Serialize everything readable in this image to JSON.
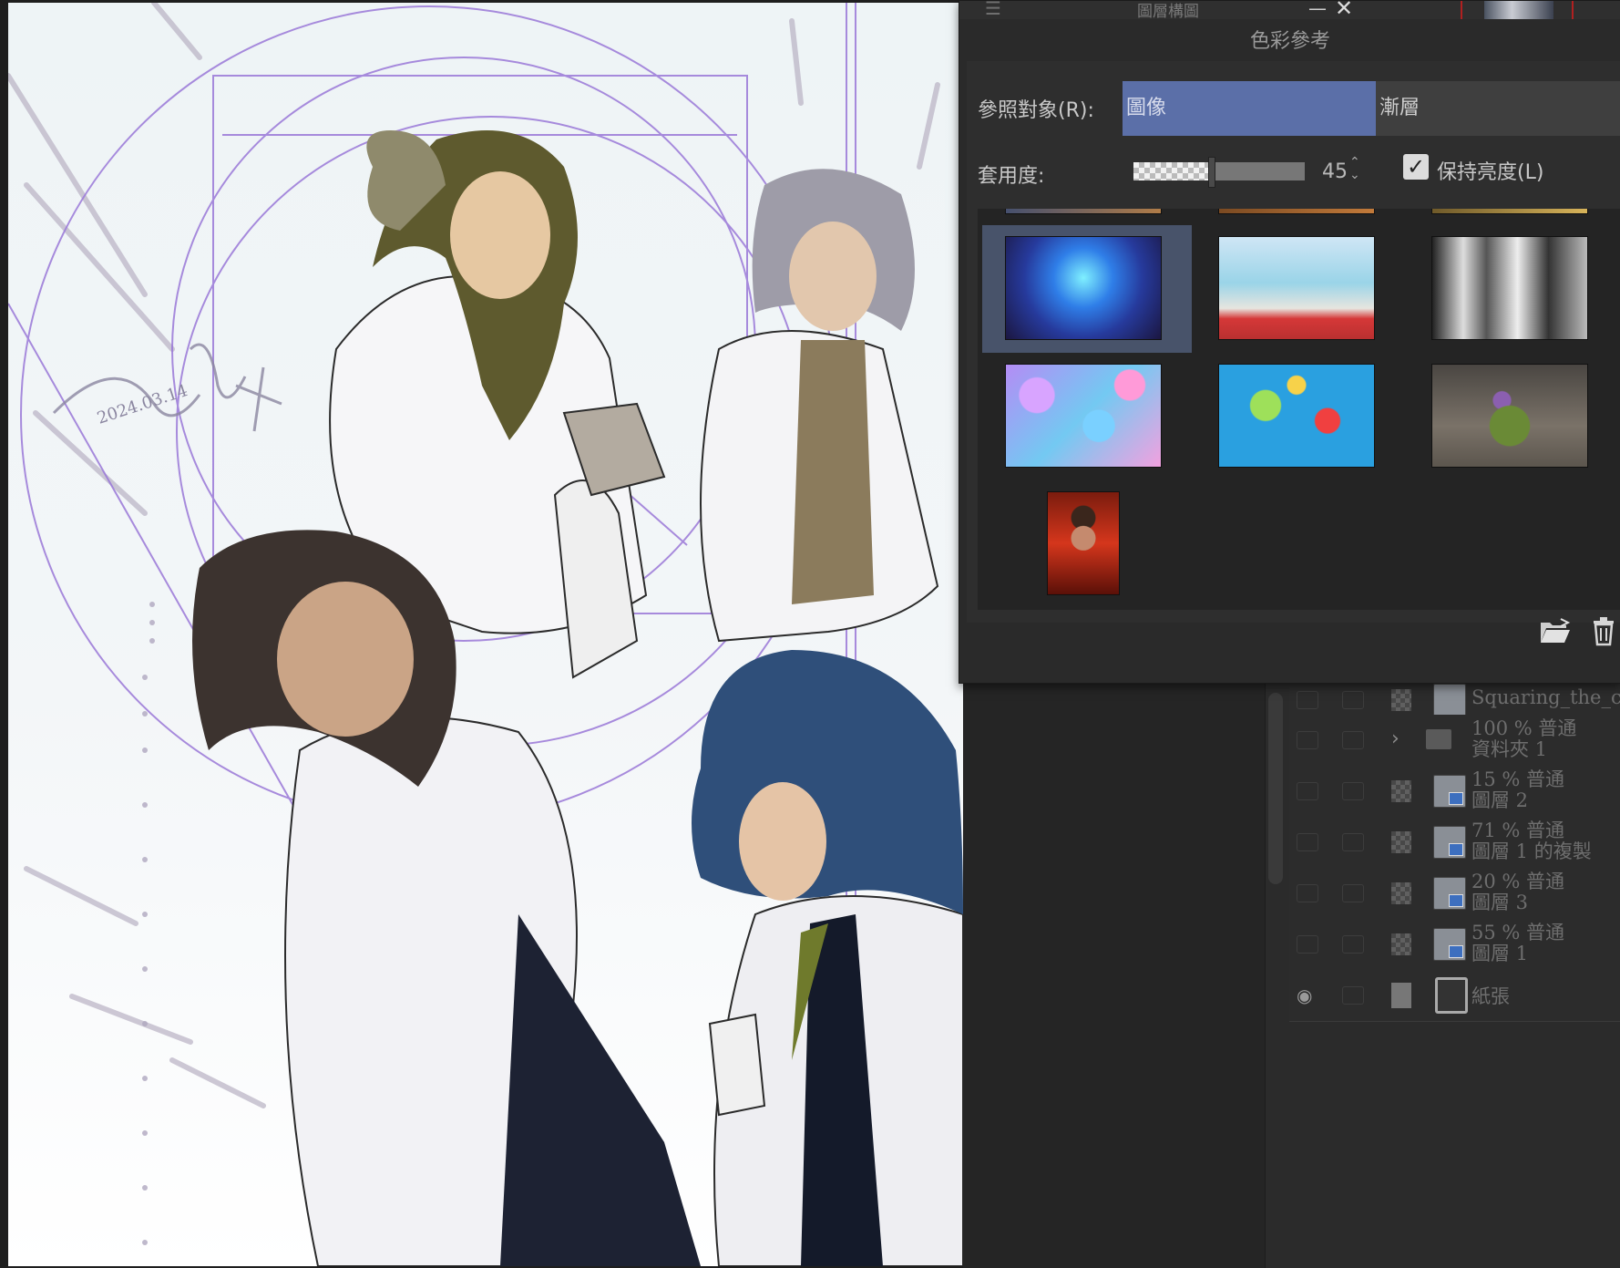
{
  "color_reference_panel": {
    "window_title": "圖層構圖",
    "panel_title": "色彩參考",
    "reference_target_label": "參照對象(R):",
    "tabs": [
      {
        "label": "圖像",
        "selected": true
      },
      {
        "label": "漸層",
        "selected": false
      }
    ],
    "opacity_label": "套用度:",
    "opacity_value": "45",
    "opacity_percent": 45,
    "keep_brightness_label": "保持亮度(L)",
    "keep_brightness_checked": true,
    "accent_color": "#5b6fa8",
    "thumbnails": [
      {
        "name": "blue-energy-swirl",
        "selected": true
      },
      {
        "name": "office-interior-red-chairs",
        "selected": false
      },
      {
        "name": "monochrome-street",
        "selected": false
      },
      {
        "name": "watercolor-circles",
        "selected": false
      },
      {
        "name": "floral-butterfly-pattern",
        "selected": false
      },
      {
        "name": "flower-plant-photo",
        "selected": false
      },
      {
        "name": "red-character-illustration",
        "selected": false
      }
    ]
  },
  "artwork": {
    "signature_date": "2024.03.14"
  },
  "layers": [
    {
      "name": "Squaring_the_circ",
      "mode": ""
    },
    {
      "name": "資料夾 1",
      "mode": "100 % 普通",
      "type": "folder"
    },
    {
      "name": "圖層 2",
      "mode": "15 % 普通"
    },
    {
      "name": "圖層 1 的複製",
      "mode": "71 % 普通"
    },
    {
      "name": "圖層 3",
      "mode": "20 % 普通"
    },
    {
      "name": "圖層 1",
      "mode": "55 % 普通"
    },
    {
      "name": "紙張",
      "mode": "",
      "visible": true,
      "type": "paper"
    }
  ]
}
